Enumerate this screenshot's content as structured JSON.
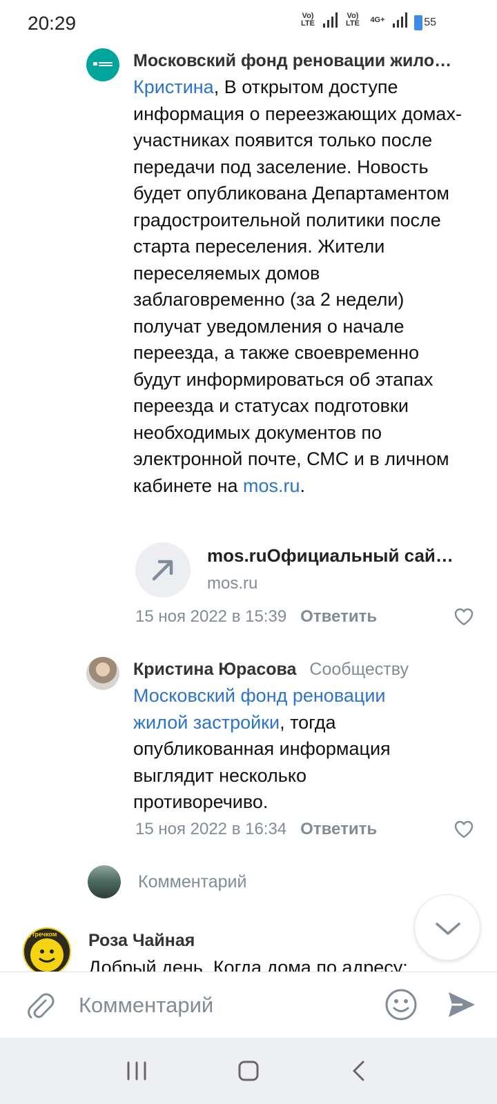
{
  "status_bar": {
    "time": "20:29",
    "network_1": "Vo) LTE",
    "network_2": "Vo) LTE",
    "network_3": "4G+",
    "battery": "55"
  },
  "comments": [
    {
      "author": "Московский фонд реновации жило…",
      "mention": "Кристина",
      "text": ", В открытом доступе информация о переезжающих домах-участниках появится только после передачи под заселение. Новость будет опубликована Департаментом градостроительной политики после старта переселения. Жители переселяемых домов заблаговременно (за 2 недели) получат уведомления о начале переезда, а также своевременно будут информироваться об этапах переезда и статусах подготовки необходимых документов по электронной почте, СМС и в личном кабинете на ",
      "inline_link": "mos.ru",
      "text_end": ".",
      "preview": {
        "title": "mos.ruОфициальный сай…",
        "domain": "mos.ru"
      },
      "date": "15 ноя 2022 в 15:39",
      "reply_label": "Ответить"
    },
    {
      "author": "Кристина Юрасова",
      "to_label": "Сообществу",
      "mention": "Московский фонд реновации жилой застройки",
      "text": ", тогда опубликованная информация выглядит несколько противоречиво.",
      "date": "15 ноя 2022 в 16:34",
      "reply_label": "Ответить"
    }
  ],
  "reply_input": {
    "placeholder": "Комментарий"
  },
  "next_comment": {
    "author": "Роза Чайная",
    "text": "Добрый день. Когда дома по адресу:",
    "avatar_text": "утречком"
  },
  "composer": {
    "placeholder": "Комментарий"
  },
  "icons": {
    "attach": "paperclip-icon",
    "emoji": "smiley-icon",
    "send": "send-icon",
    "scroll": "chevron-down-icon",
    "link": "arrow-up-right-icon",
    "like": "heart-icon"
  },
  "colors": {
    "link": "#2b74c9",
    "secondary": "#818c99",
    "accent": "#00a59b"
  }
}
